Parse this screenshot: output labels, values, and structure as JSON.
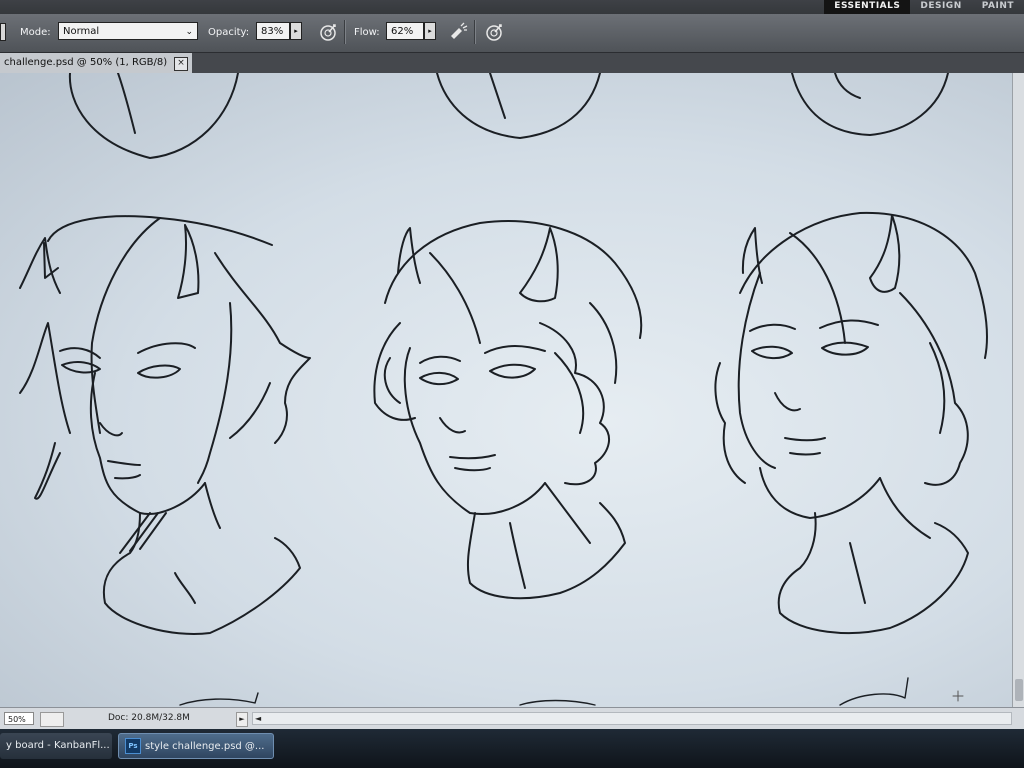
{
  "workspace": {
    "tabs": [
      "ESSENTIALS",
      "DESIGN",
      "PAINT"
    ],
    "active": "ESSENTIALS"
  },
  "options": {
    "mode_label": "Mode:",
    "mode_value": "Normal",
    "opacity_label": "Opacity:",
    "opacity_value": "83%",
    "flow_label": "Flow:",
    "flow_value": "62%"
  },
  "document": {
    "tab_title": "challenge.psd @ 50% (1, RGB/8)",
    "close_glyph": "×"
  },
  "status": {
    "zoom": "50%",
    "doc_info": "Doc: 20.8M/32.8M",
    "arrow": "►",
    "scroll_left": "◄"
  },
  "taskbar": {
    "items": [
      {
        "label": "y board - KanbanFl..."
      },
      {
        "icon_text": "Ps",
        "label": "style challenge.psd @..."
      }
    ]
  },
  "colors": {
    "ui_dark": "#4f5358",
    "canvas": "#dde6ec",
    "ink": "#1b1f24",
    "taskbar": "#1f2a36"
  }
}
